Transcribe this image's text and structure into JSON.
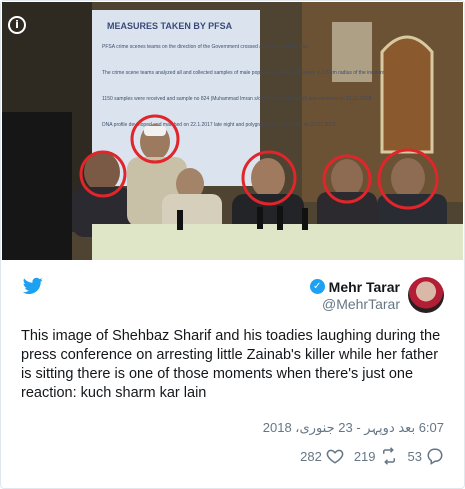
{
  "tweet": {
    "author_name": "Mehr Tarar",
    "author_handle": "@MehrTarar",
    "text": "This image of Shehbaz Sharif and his toadies laughing during the press conference on arresting little Zainab's killer while her father is sitting there is one of those moments when there's just one reaction: kuch sharm kar lain",
    "timestamp": "6:07 بعد دوپہر - 23 جنوری، 2018",
    "likes": "282",
    "retweets": "219",
    "replies": "53"
  },
  "photo": {
    "slide_title": "MEASURES TAKEN BY PFSA",
    "slide_lines": [
      "PFSA crime scenes teams on the direction of the Government crossed at home on 24/7 basis",
      "The crime scene teams analyzed all and collected samples of male population aged 20-45 years in 1.5 km radius of the incident",
      "1150 samples were received and sample no 824 (Muhammad Imran s/o Muhammad Arshad) was received on 21.01.2018",
      "DNA profile developed and matched on 22.1.2017 late night and polygraph was conducted on 23.01.2018"
    ]
  },
  "icons": {
    "info": "info-icon",
    "bird": "twitter-bird-icon",
    "verified": "verified-badge-icon",
    "like": "heart-icon",
    "retweet": "retweet-icon",
    "reply": "reply-icon"
  },
  "colors": {
    "twitter_blue": "#1da1f2",
    "meta_gray": "#657786",
    "circle_red": "#e0252b"
  }
}
